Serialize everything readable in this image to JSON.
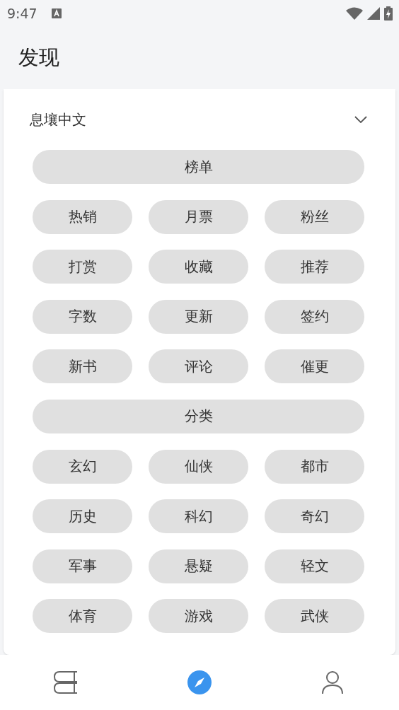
{
  "status_bar": {
    "time": "9:47"
  },
  "title": "发现",
  "source": {
    "name": "息壤中文",
    "expanded": true
  },
  "sections": [
    {
      "title": "榜单",
      "items": [
        "热销",
        "月票",
        "粉丝",
        "打赏",
        "收藏",
        "推荐",
        "字数",
        "更新",
        "签约",
        "新书",
        "评论",
        "催更"
      ]
    },
    {
      "title": "分类",
      "items": [
        "玄幻",
        "仙侠",
        "都市",
        "历史",
        "科幻",
        "奇幻",
        "军事",
        "悬疑",
        "轻文",
        "体育",
        "游戏",
        "武侠"
      ]
    }
  ],
  "bottom_nav": [
    {
      "kind": "bookshelf",
      "selected": false
    },
    {
      "kind": "discover",
      "selected": true
    },
    {
      "kind": "profile",
      "selected": false
    }
  ]
}
